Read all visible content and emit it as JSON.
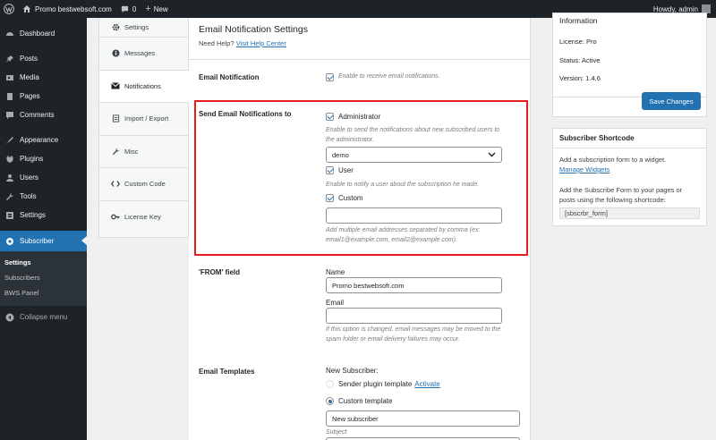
{
  "adminbar": {
    "site_name": "Promo bestwebsoft.com",
    "comments_count": "0",
    "new_label": "New",
    "howdy": "Howdy, admin"
  },
  "sidebar": {
    "items": [
      {
        "label": "Dashboard",
        "icon": "dashboard-icon"
      },
      {
        "label": "Posts",
        "icon": "pin-icon"
      },
      {
        "label": "Media",
        "icon": "media-icon"
      },
      {
        "label": "Pages",
        "icon": "page-icon"
      },
      {
        "label": "Comments",
        "icon": "comment-icon"
      },
      {
        "label": "Appearance",
        "icon": "brush-icon"
      },
      {
        "label": "Plugins",
        "icon": "plugin-icon"
      },
      {
        "label": "Users",
        "icon": "users-icon"
      },
      {
        "label": "Tools",
        "icon": "wrench-icon"
      },
      {
        "label": "Settings",
        "icon": "settings-icon"
      },
      {
        "label": "Subscriber",
        "icon": "subscriber-icon"
      }
    ],
    "submenu": [
      "Settings",
      "Subscribers",
      "BWS Panel"
    ],
    "collapse": "Collapse menu"
  },
  "tabs": [
    {
      "label": "Settings",
      "icon": "gear-icon"
    },
    {
      "label": "Messages",
      "icon": "info-icon"
    },
    {
      "label": "Notifications",
      "icon": "envelope-icon"
    },
    {
      "label": "Import / Export",
      "icon": "import-icon"
    },
    {
      "label": "Misc",
      "icon": "wrench-icon"
    },
    {
      "label": "Custom Code",
      "icon": "code-icon"
    },
    {
      "label": "License Key",
      "icon": "key-icon"
    }
  ],
  "main": {
    "title": "Email Notification Settings",
    "help_prefix": "Need Help?",
    "help_link": "Visit Help Center",
    "email_notification": {
      "label": "Email Notification",
      "checkbox_text": "Enable to receive email notifications."
    },
    "send_to": {
      "label": "Send Email Notifications to",
      "administrator": "Administrator",
      "admin_desc_1": "Enable to send the notifications about new subscribed users to",
      "admin_desc_2": "the administrator.",
      "admin_select": "demo",
      "user": "User",
      "user_desc": "Enable to notify a user about the subscription he made.",
      "custom": "Custom",
      "custom_value": "",
      "custom_desc_1": "Add multiple email addresses separated by comma (ex:",
      "custom_desc_2": "email1@example.com, email2@example.com)."
    },
    "from": {
      "label": "'FROM' field",
      "name_label": "Name",
      "name_value": "Promo bestwebsoft.com",
      "email_label": "Email",
      "email_value": "",
      "desc_1": "If this option is changed, email messages may be moved to the",
      "desc_2": "spam folder or email delivery failures may occur."
    },
    "templates": {
      "label": "Email Templates",
      "new_subscriber": "New Subscriber:",
      "sender_plugin": "Sender plugin template",
      "activate": "Activate",
      "custom_template": "Custom template",
      "subject_value": "New subscriber",
      "subject_label": "Subject"
    }
  },
  "info": {
    "title": "Information",
    "license": "License: Pro",
    "status": "Status: Active",
    "version": "Version: 1.4.6",
    "save": "Save Changes"
  },
  "shortcode": {
    "title": "Subscriber Shortcode",
    "text1": "Add a subscription form to a widget.",
    "link": "Manage Widgets",
    "text2_1": "Add the Subscribe Form to your pages or",
    "text2_2": "posts using the following shortcode:",
    "code": "[sbscrbr_form]"
  },
  "colors": {
    "accent": "#2271b1",
    "sidebar": "#1d2327",
    "highlight": "#e41e1e"
  }
}
